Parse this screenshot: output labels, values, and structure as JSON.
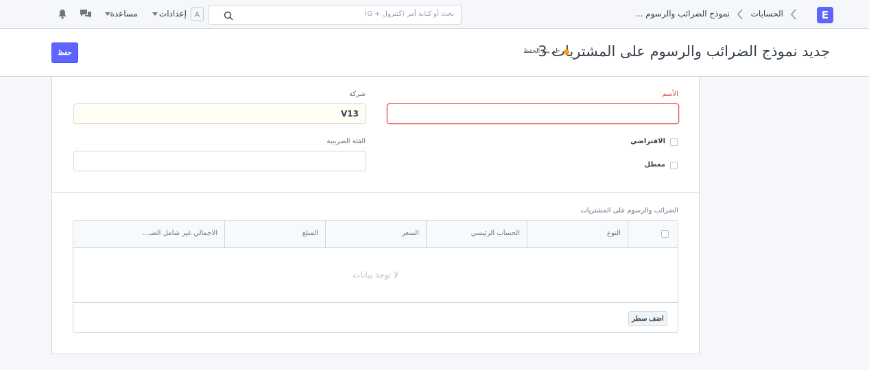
{
  "navbar": {
    "logo": "E",
    "breadcrumbs": [
      "الحسابات",
      "نموذج الضرائب والرسوم ..."
    ],
    "search_placeholder": "بحث أو كتابة أمر (كنترول + G)",
    "avatar_letter": "A",
    "settings_label": "إعدادات",
    "help_label": "مساعدة"
  },
  "page": {
    "title": "جديد نموذج الضرائب والرسوم على المشتريات 3",
    "status": "لم يتم الحفظ",
    "save_label": "حفظ"
  },
  "form": {
    "name_label": "الأسم",
    "name_value": "",
    "company_label": "شركة",
    "company_value": "V13",
    "default_label": "الافتراضي",
    "disabled_label": "معطل",
    "tax_category_label": "الفئة الضريبية",
    "tax_category_value": ""
  },
  "table": {
    "label": "الضرائب والرسوم على المشتريات",
    "columns": [
      "النوع",
      "الحساب الرئيسي",
      "السعر",
      "المبلغ",
      "الاجمالي غير شامل الضـ..."
    ],
    "empty_text": "لا توجد بيانات",
    "add_row_label": "اضف سطر"
  },
  "colors": {
    "primary": "#5e64ff",
    "error": "#e24c4c",
    "indicator": "#ffa00a"
  }
}
